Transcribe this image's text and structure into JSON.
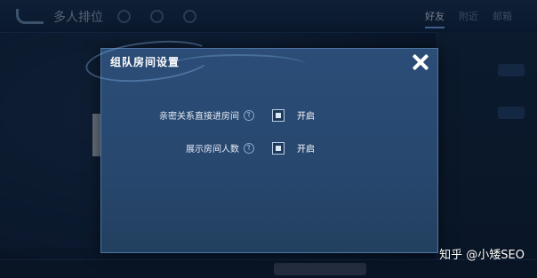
{
  "background": {
    "title": "多人排位",
    "tabs": [
      "好友",
      "附近",
      "邮箱"
    ],
    "active_tab": 0
  },
  "dialog": {
    "title": "组队房间设置",
    "settings": [
      {
        "label": "亲密关系直接进房间",
        "checked": true,
        "state": "开启"
      },
      {
        "label": "展示房间人数",
        "checked": true,
        "state": "开启"
      }
    ],
    "help_glyph": "?"
  },
  "watermark": "知乎 @小矮SEO"
}
